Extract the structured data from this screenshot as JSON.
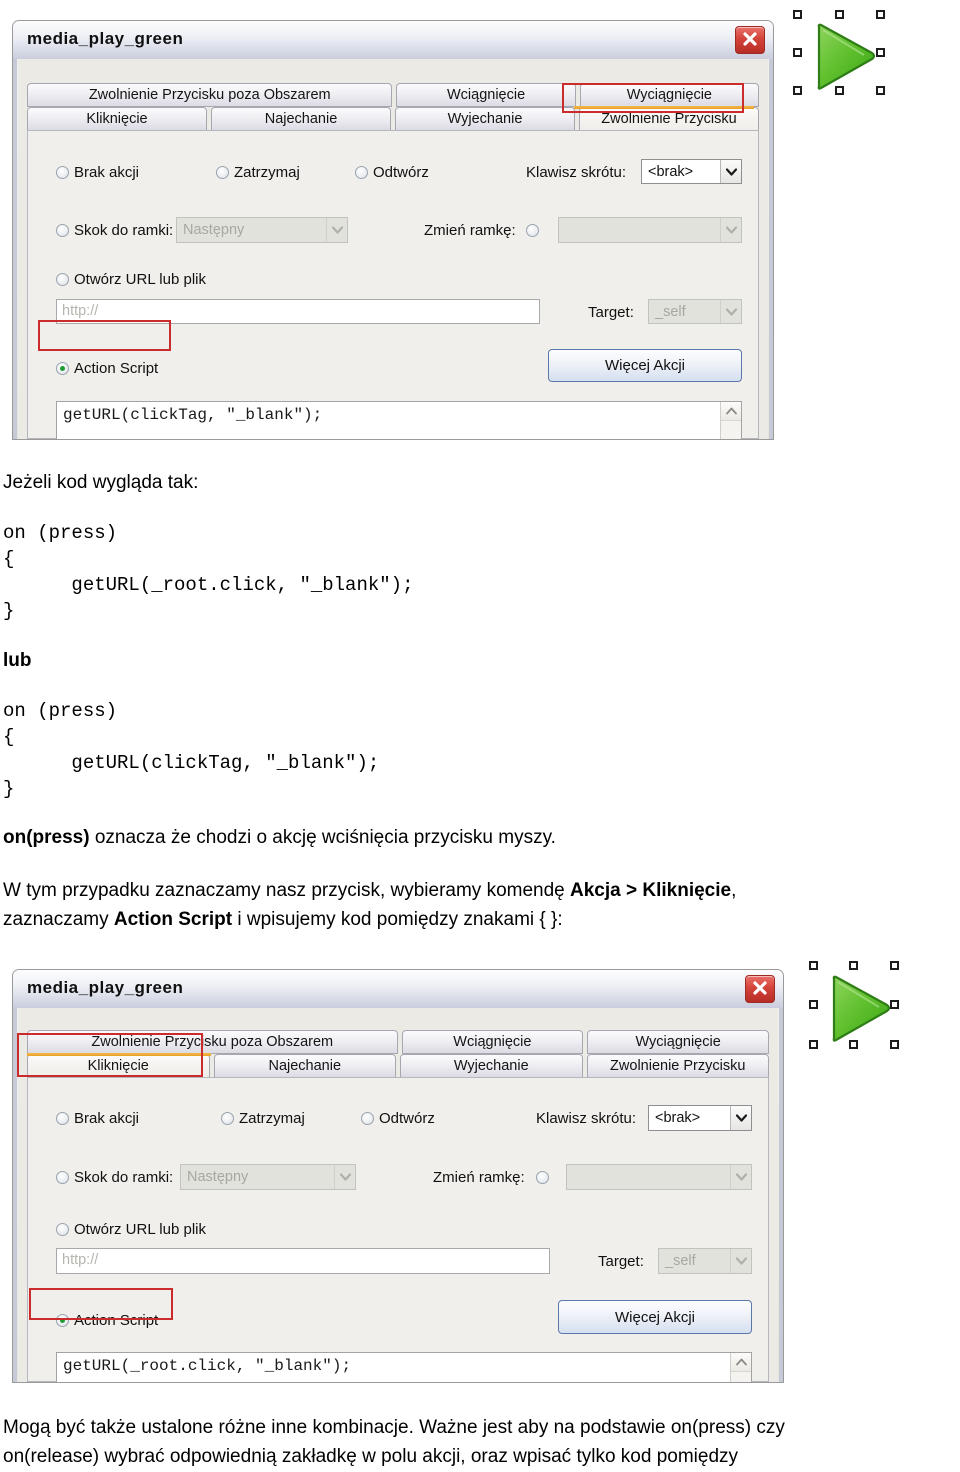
{
  "dialog": {
    "title": "media_play_green",
    "close_icon": "close-icon",
    "tabs_row1": [
      {
        "label": "Zwolnienie Przycisku poza Obszarem"
      },
      {
        "label": "Wciągnięcie"
      },
      {
        "label": "Wyciągnięcie"
      }
    ],
    "tabs_row2": [
      {
        "label": "Kliknięcie"
      },
      {
        "label": "Najechanie"
      },
      {
        "label": "Wyjechanie"
      },
      {
        "label": "Zwolnienie Przycisku"
      }
    ],
    "radios": {
      "brak_akcji": "Brak akcji",
      "zatrzymaj": "Zatrzymaj",
      "odtworz": "Odtwórz",
      "skok_do_ramki": "Skok do ramki:",
      "zmien_ramke": "Zmień ramkę:",
      "otworz_url": "Otwórz URL lub plik",
      "action_script": "Action Script"
    },
    "labels": {
      "klawisz_skrotu": "Klawisz skrótu:",
      "target": "Target:"
    },
    "values": {
      "klawisz_skrotu": "<brak>",
      "skok_do_ramki": "Następny",
      "zmien_ramke": "",
      "url_placeholder": "http://",
      "target": "_self"
    },
    "buttons": {
      "wiecej_akcji": "Więcej Akcji"
    }
  },
  "dialog_top": {
    "active_tab": "Zwolnienie Przycisku",
    "code": "getURL(clickTag, \"_blank\");"
  },
  "dialog_bottom": {
    "active_tab": "Kliknięcie",
    "code": "getURL(_root.click, \"_blank\");"
  },
  "artboard": {
    "icon_name": "green-play-triangle-icon",
    "icon_color": "#5abb2a",
    "handle_count": 8
  },
  "text": {
    "heading1": "Jeżeli kod wygląda tak:",
    "code_block1": "on (press)\n{\n      getURL(_root.click, \"_blank\");\n}",
    "lub": "lub",
    "code_block2": "on (press)\n{\n      getURL(clickTag, \"_blank\");\n}",
    "para1_bold": "on(press)",
    "para1_rest": " oznacza że chodzi o akcję wciśnięcia przycisku myszy.",
    "para2_a": "W tym przypadku zaznaczamy nasz przycisk, wybieramy komendę ",
    "para2_b": "Akcja > Kliknięcie",
    "para2_c": ",",
    "para2_d": "zaznaczamy ",
    "para2_e": "Action Script",
    "para2_f": " i wpisujemy kod pomiędzy znakami { }:",
    "footer_line1": "Mogą być także ustalone różne inne kombinacje. Ważne jest aby na podstawie on(press) czy",
    "footer_line2": "on(release) wybrać odpowiednią zakładkę w polu akcji, oraz wpisać tylko kod pomiędzy"
  }
}
